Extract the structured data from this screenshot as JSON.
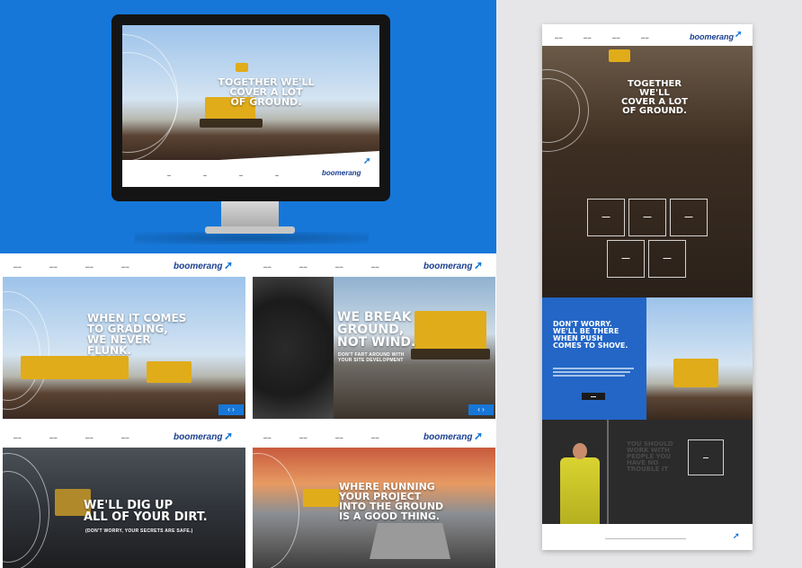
{
  "brand": {
    "logo_text": "boomerang",
    "logo_mark": "boomerang-swoosh-icon",
    "accent_color": "#1677d9",
    "navy_color": "#1a3f8f"
  },
  "hero_monitor": {
    "headline_line1": "TOGETHER WE'LL",
    "headline_line2": "COVER A LOT",
    "headline_line3": "OF GROUND."
  },
  "cards": [
    {
      "headline_line1": "WHEN IT COMES",
      "headline_line2": "TO GRADING,",
      "headline_line3": "WE NEVER",
      "headline_line4": "FLUNK.",
      "arrows": "‹ ›"
    },
    {
      "headline_line1": "WE BREAK",
      "headline_line2": "GROUND,",
      "headline_line3": "NOT WIND.",
      "sub_line1": "DON'T FART AROUND WITH",
      "sub_line2": "YOUR SITE DEVELOPMENT",
      "arrows": "‹ ›"
    },
    {
      "headline_line1": "WE'LL DIG UP",
      "headline_line2": "ALL OF YOUR DIRT.",
      "sub_line1": "(DON'T WORRY, YOUR SECRETS ARE SAFE.)"
    },
    {
      "headline_line1": "WHERE RUNNING",
      "headline_line2": "YOUR PROJECT",
      "headline_line3": "INTO THE GROUND",
      "headline_line4": "IS A GOOD THING."
    }
  ],
  "tall_page": {
    "headline_line1": "TOGETHER WE'LL",
    "headline_line2": "COVER A LOT",
    "headline_line3": "OF GROUND.",
    "blue_headline_line1": "DON'T WORRY.",
    "blue_headline_line2": "WE'LL BE THERE",
    "blue_headline_line3": "WHEN PUSH",
    "blue_headline_line4": "COMES TO SHOVE.",
    "survey_headline_line1": "YOU SHOULD",
    "survey_headline_line2": "WORK WITH",
    "survey_headline_line3": "PEOPLE YOU",
    "survey_headline_line4": "HAVE NO",
    "survey_headline_line5": "TROUBLE IT"
  }
}
